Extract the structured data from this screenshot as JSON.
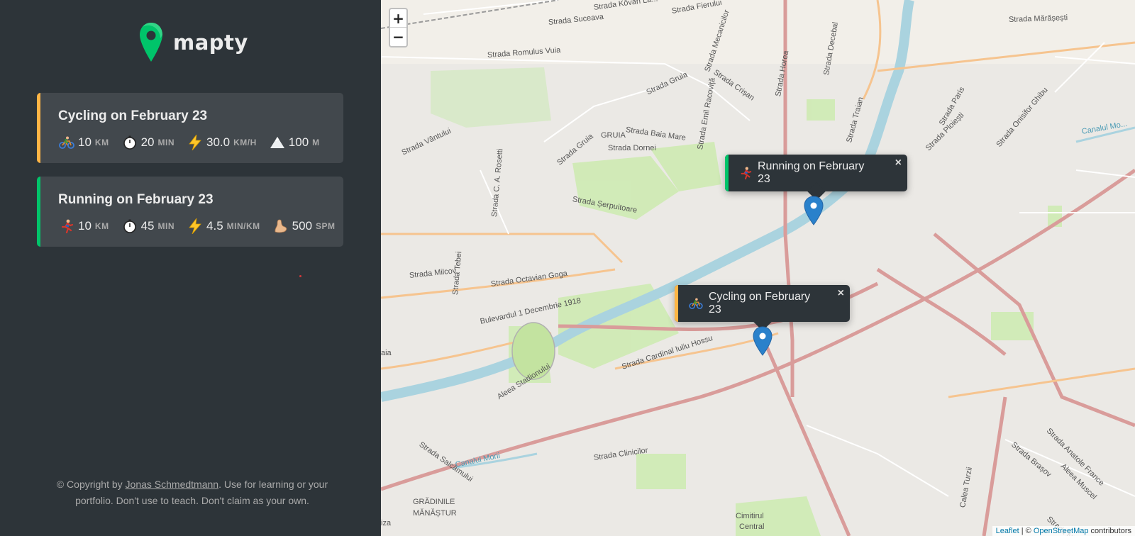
{
  "app": {
    "logo_text": "mapty"
  },
  "workouts": [
    {
      "type": "cycling",
      "title": "Cycling on February 23",
      "details": [
        {
          "icon": "bicyclist-icon",
          "value": "10",
          "unit": "km"
        },
        {
          "icon": "stopwatch-icon",
          "value": "20",
          "unit": "min"
        },
        {
          "icon": "lightning-icon",
          "value": "30.0",
          "unit": "km/h"
        },
        {
          "icon": "mountain-icon",
          "value": "100",
          "unit": "m"
        }
      ]
    },
    {
      "type": "running",
      "title": "Running on February 23",
      "details": [
        {
          "icon": "runner-icon",
          "value": "10",
          "unit": "km"
        },
        {
          "icon": "stopwatch-icon",
          "value": "45",
          "unit": "min"
        },
        {
          "icon": "lightning-icon",
          "value": "4.5",
          "unit": "min/km"
        },
        {
          "icon": "footprint-icon",
          "value": "500",
          "unit": "spm"
        }
      ]
    }
  ],
  "copyright": {
    "prefix": "© Copyright by ",
    "author": "Jonas Schmedtmann",
    "suffix": ". Use for learning or your portfolio. Don't use to teach. Don't claim as your own."
  },
  "map": {
    "zoom_in": "+",
    "zoom_out": "−",
    "popups": [
      {
        "type": "running",
        "text": "Running on February 23",
        "close": "×"
      },
      {
        "type": "cycling",
        "text": "Cycling on February 23",
        "close": "×"
      }
    ],
    "attribution": {
      "leaflet": "Leaflet",
      "sep": " | © ",
      "osm": "OpenStreetMap",
      "suffix": " contributors"
    },
    "street_labels": [
      "Strada Kővári La...",
      "Strada Fierului",
      "Strada Suceava",
      "Strada Mecanicilor",
      "Strada Romulus Vuia",
      "Strada Gruia",
      "Strada Crișan",
      "Strada Horea",
      "Strada Decebal",
      "Strada Traian",
      "Strada Mărășești",
      "Strada Vântului",
      "GRUIA",
      "Strada Baia Mare",
      "Strada Dornei",
      "Strada Gruia",
      "Strada Emil Racoviță",
      "Strada C. A. Rosetti",
      "Strada Șerpuitoare",
      "Strada Ploiești",
      "Strada Paris",
      "Strada Onisifor Ghibu",
      "Canalul Mo...",
      "Strada Milcov",
      "Strada Octavian Goga",
      "Strada Tebei",
      "Bulevardul 1 Decembrie 1918",
      "Strada Cardinal Iuliu Hossu",
      "Aleea Stadionului",
      "Strada Salcâmului",
      "Canalul Morii",
      "Strada Clinicilor",
      "GRĂDINILE",
      "MĂNĂȘTUR",
      "Cimitirul",
      "Central",
      "Calea Turzii",
      "Strada Brașov",
      "Strada Anatole France",
      "Aleea Muscel",
      "Strada Ni...",
      "aia",
      "iza"
    ]
  },
  "colors": {
    "sidebar": "#2d3439",
    "card": "#42484d",
    "cycling": "#ffb545",
    "running": "#00c46a",
    "brand": "#00c46a"
  }
}
